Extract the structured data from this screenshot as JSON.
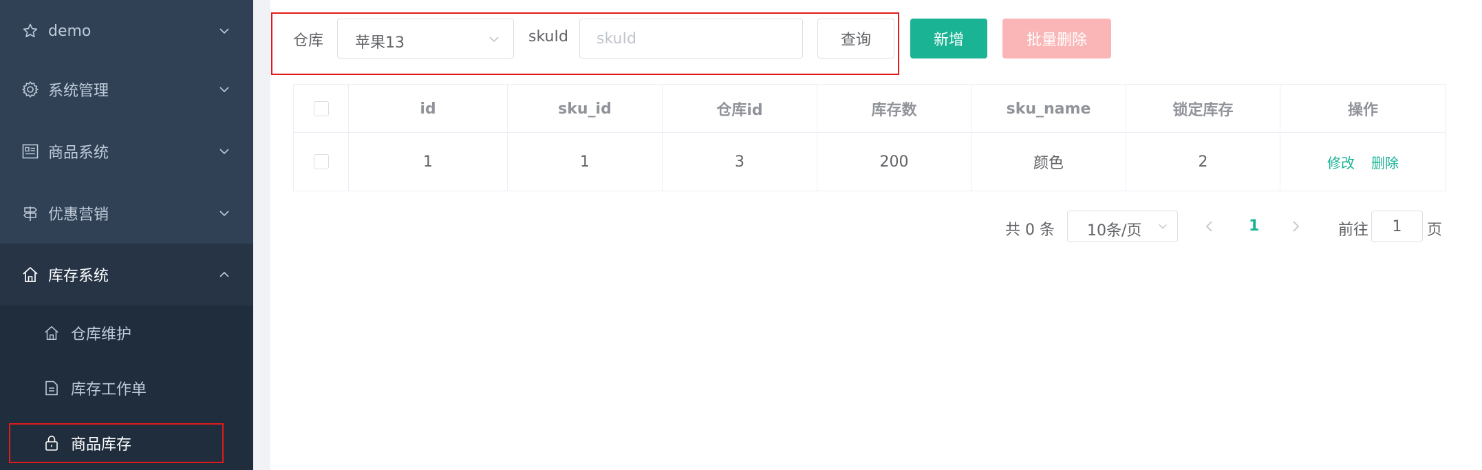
{
  "sidebar": {
    "items": [
      {
        "label": "demo",
        "icon": "star-icon"
      },
      {
        "label": "系统管理",
        "icon": "gear-icon"
      },
      {
        "label": "商品系统",
        "icon": "list-icon"
      },
      {
        "label": "优惠营销",
        "icon": "signpost-icon"
      },
      {
        "label": "库存系统",
        "icon": "home-icon"
      }
    ],
    "subitems": [
      {
        "label": "仓库维护",
        "icon": "home-icon"
      },
      {
        "label": "库存工作单",
        "icon": "document-icon"
      },
      {
        "label": "商品库存",
        "icon": "lock-icon"
      }
    ]
  },
  "search": {
    "warehouse_label": "仓库",
    "warehouse_value": "苹果13",
    "sku_label": "skuId",
    "sku_placeholder": "skuId",
    "query_button": "查询",
    "add_button": "新增",
    "batch_delete_button": "批量删除"
  },
  "table": {
    "headers": [
      "id",
      "sku_id",
      "仓库id",
      "库存数",
      "sku_name",
      "锁定库存",
      "操作"
    ],
    "rows": [
      {
        "id": "1",
        "sku_id": "1",
        "ware_id": "3",
        "stock": "200",
        "sku_name": "颜色",
        "stock_locked": "2",
        "edit": "修改",
        "delete": "删除"
      }
    ]
  },
  "pagination": {
    "total": "共 0 条",
    "page_size": "10条/页",
    "current": "1",
    "goto_label": "前往",
    "goto_value": "1",
    "page_suffix": "页"
  },
  "colors": {
    "sidebar_bg": "#304156",
    "primary": "#1ab394",
    "danger_disabled": "#fab6b6",
    "highlight": "#e01b1b"
  }
}
